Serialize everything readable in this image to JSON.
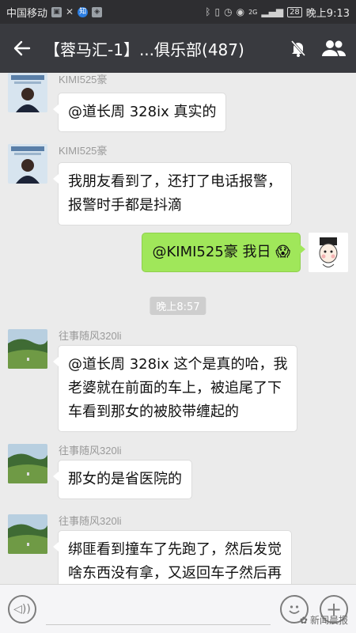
{
  "status_bar": {
    "carrier": "中国移动",
    "time": "晚上9:13",
    "battery": "28",
    "network": "2G",
    "app_badge": "知"
  },
  "header": {
    "title": "【蓉马汇-1】...俱乐部(487)",
    "back_icon": "arrow-left-icon",
    "mute_icon": "bell-off-icon",
    "group_icon": "group-members-icon"
  },
  "messages": [
    {
      "sender": "KIMI525豪",
      "text_lines": [
        "@道长周 328ix  真实的"
      ],
      "side": "left"
    },
    {
      "sender": "KIMI525豪",
      "text_lines": [
        "我朋友看到了，还打了电话报警，",
        "报警时手都是抖滴"
      ],
      "side": "left"
    },
    {
      "sender": "",
      "text_lines": [
        "@KIMI525豪  我日"
      ],
      "emoji": "😱",
      "side": "right"
    },
    {
      "timestamp": "晚上8:57"
    },
    {
      "sender": "往事随风320li",
      "text_lines": [
        "@道长周 328ix  这个是真的哈，我",
        "老婆就在前面的车上，被追尾了下",
        "车看到那女的被胶带缠起的"
      ],
      "side": "left"
    },
    {
      "sender": "往事随风320li",
      "text_lines": [
        "那女的是省医院的"
      ],
      "side": "left"
    },
    {
      "sender": "往事随风320li",
      "text_lines": [
        "绑匪看到撞车了先跑了，然后发觉",
        "啥东西没有拿，又返回车子然后再"
      ],
      "side": "left"
    }
  ],
  "input_bar": {
    "voice_icon": "voice-icon",
    "emoji_icon": "emoji-icon",
    "plus_icon": "plus-icon",
    "watermark": "新闻晨报"
  },
  "colors": {
    "title_bar": "#393a3f",
    "status_bar": "#2e2e31",
    "chat_bg": "#ebebeb",
    "my_bubble": "#a0e75a",
    "other_bubble": "#ffffff"
  }
}
